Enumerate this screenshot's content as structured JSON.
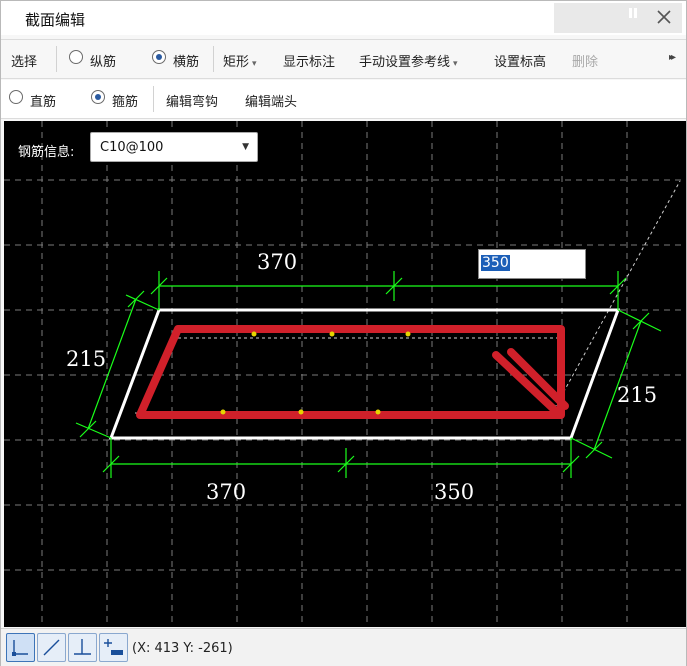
{
  "title": "截面编辑",
  "toolbar1": {
    "select_label": "选择",
    "longitudinal_label": "纵筋",
    "transverse_label": "横筋",
    "shape_label": "矩形",
    "show_dims_label": "显示标注",
    "manual_ref_label": "手动设置参考线",
    "set_elev_label": "设置标高",
    "delete_label": "删除"
  },
  "toolbar2": {
    "straight_label": "直筋",
    "stirrup_label": "箍筋",
    "edit_hook_label": "编辑弯钩",
    "edit_end_label": "编辑端头"
  },
  "rebar_info": {
    "label": "钢筋信息:",
    "value": "C10@100"
  },
  "edit_input": {
    "value": "350"
  },
  "dimensions": {
    "top": "370",
    "left": "215",
    "right": "215",
    "bottom_left": "370",
    "bottom_right": "350"
  },
  "status": {
    "coord": "(X: 413 Y: -261)"
  },
  "colors": {
    "rebar": "#d0202a",
    "dimension": "#1aff1a",
    "outline": "#ffffff",
    "canvas": "#000000",
    "grid": "#7a7a7a"
  },
  "icons": [
    "pin-icon",
    "close-icon",
    "more-icon",
    "snap-endpoint-icon",
    "snap-line-icon",
    "snap-perpendicular-icon",
    "snap-add-icon"
  ]
}
